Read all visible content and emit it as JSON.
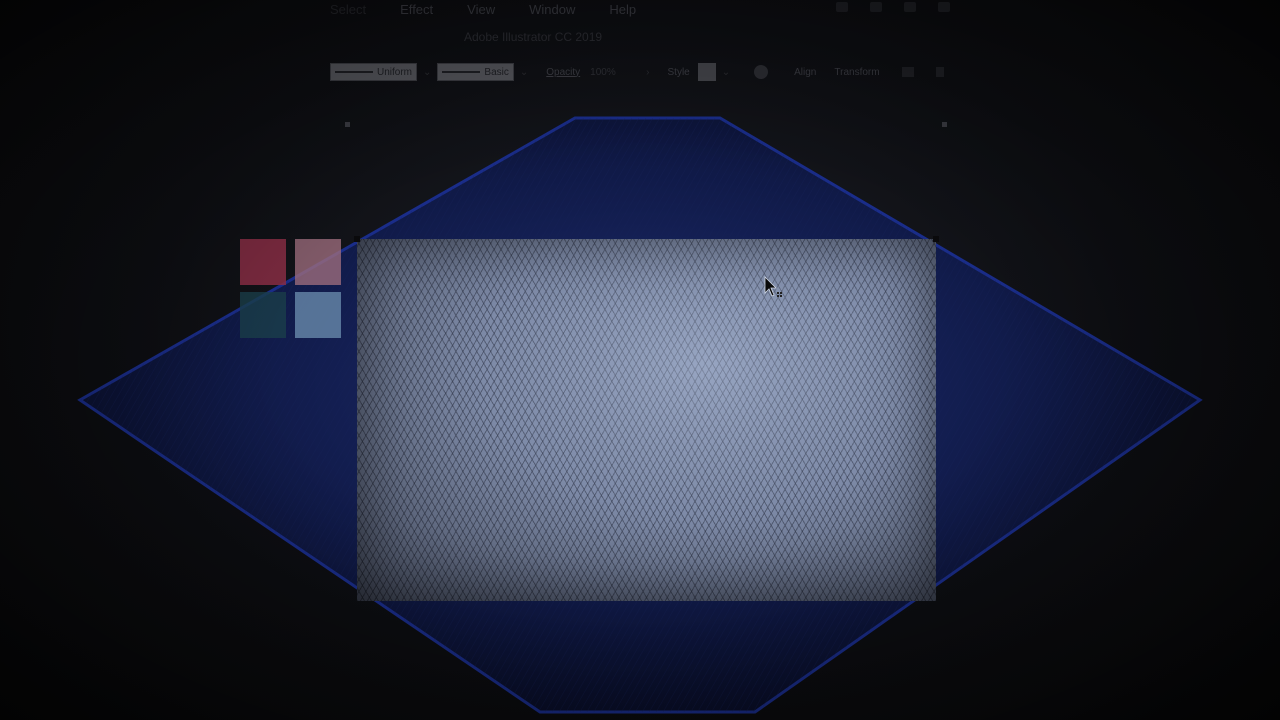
{
  "window": {
    "app_title": "Adobe Illustrator CC 2019"
  },
  "menubar": {
    "items": [
      {
        "label": "Select"
      },
      {
        "label": "Effect"
      },
      {
        "label": "View"
      },
      {
        "label": "Window"
      },
      {
        "label": "Help"
      }
    ]
  },
  "controlbar": {
    "stroke_profile": "Uniform",
    "brush_definition": "Basic",
    "opacity_label": "Opacity",
    "opacity_value": "100%",
    "style_label": "Style",
    "align_label": "Align",
    "transform_label": "Transform"
  },
  "swatches": [
    {
      "name": "red",
      "color": "#8b2e45"
    },
    {
      "name": "pink",
      "color": "#9b6c7c"
    },
    {
      "name": "teal",
      "color": "#1a3f4a"
    },
    {
      "name": "light-blue",
      "color": "#6e90b0"
    }
  ],
  "colors": {
    "diamond_fill": "#0e1a4a",
    "diamond_stroke": "#1a2f8f",
    "artboard": "#7f8ba6"
  },
  "icons": {
    "cursor": "arrow-cursor-icon",
    "globe": "globe-icon"
  }
}
